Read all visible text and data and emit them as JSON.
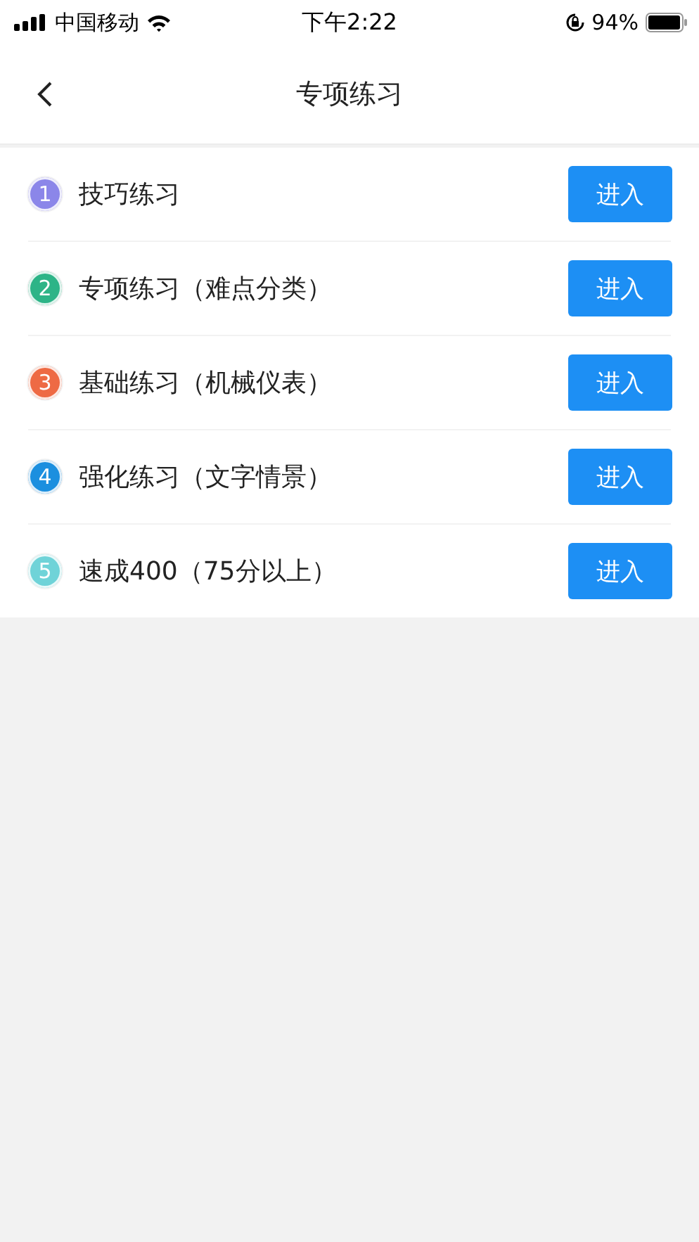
{
  "status_bar": {
    "carrier": "中国移动",
    "time": "下午2:22",
    "battery": "94%"
  },
  "nav": {
    "title": "专项练习"
  },
  "items": [
    {
      "number": "1",
      "title": "技巧练习",
      "color": "#8b86e9",
      "button": "进入"
    },
    {
      "number": "2",
      "title": "专项练习（难点分类）",
      "color": "#2db487",
      "button": "进入"
    },
    {
      "number": "3",
      "title": "基础练习（机械仪表）",
      "color": "#ee6a44",
      "button": "进入"
    },
    {
      "number": "4",
      "title": "强化练习（文字情景）",
      "color": "#1b8fdf",
      "button": "进入"
    },
    {
      "number": "5",
      "title": "速成400（75分以上）",
      "color": "#6fd3d8",
      "button": "进入"
    }
  ]
}
